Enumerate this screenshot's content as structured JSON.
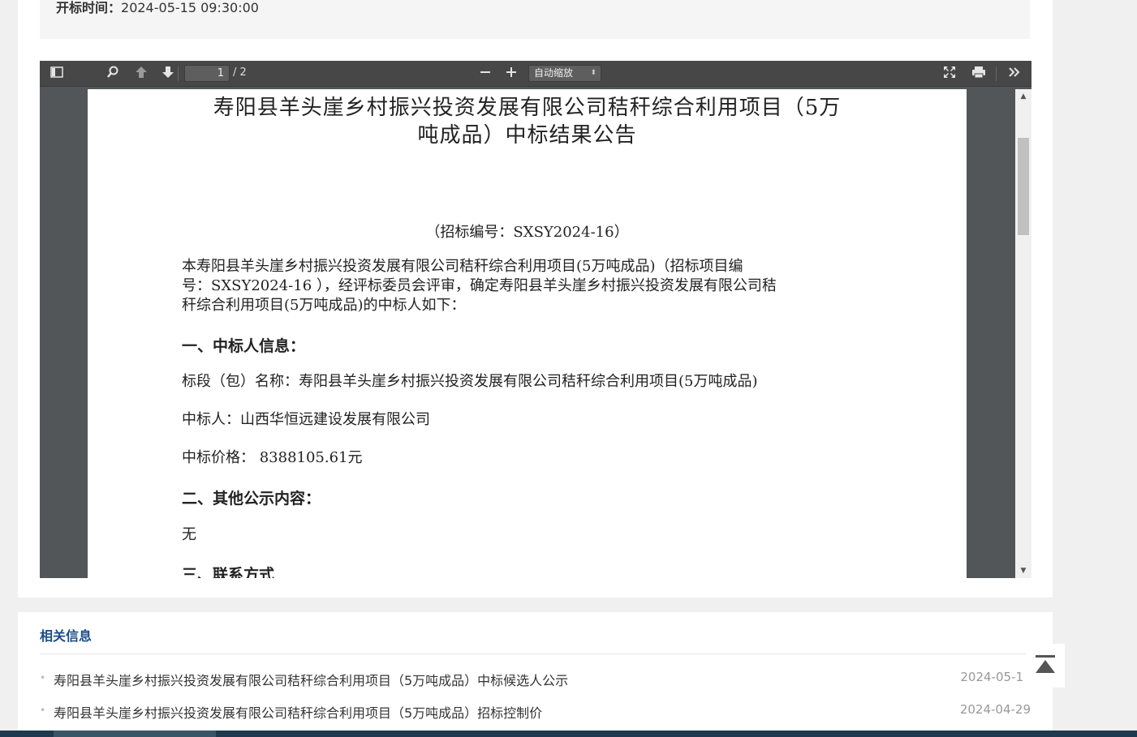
{
  "meta": {
    "label": "开标时间：",
    "value": "2024-05-15 09:30:00"
  },
  "viewer": {
    "current_page": "1",
    "total_pages": "/ 2",
    "zoom": "自动缩放",
    "icons": [
      "sidebar-toggle-icon",
      "search-icon",
      "arrow-up-icon",
      "arrow-down-icon",
      "zoom-out-icon",
      "zoom-in-icon",
      "fullscreen-icon",
      "print-icon",
      "more-tools-icon"
    ]
  },
  "document": {
    "title_line1": "寿阳县羊头崖乡村振兴投资发展有限公司秸秆综合利用项目（5万",
    "title_line2": "吨成品）中标结果公告",
    "bid_number": "（招标编号：SXSY2024-16）",
    "intro_line1": "本寿阳县羊头崖乡村振兴投资发展有限公司秸秆综合利用项目(5万吨成品)（招标项目编",
    "intro_line2": "号：SXSY2024-16 ），经评标委员会评审，确定寿阳县羊头崖乡村振兴投资发展有限公司秸",
    "intro_line3": "秆综合利用项目(5万吨成品)的中标人如下：",
    "section1": "一、中标人信息：",
    "lot_name": "标段（包）名称：寿阳县羊头崖乡村振兴投资发展有限公司秸秆综合利用项目(5万吨成品)",
    "winner": "中标人：山西华恒远建设发展有限公司",
    "price": "中标价格：  8388105.61元",
    "section2": "二、其他公示内容：",
    "other": "无",
    "section3": "三、联系方式"
  },
  "related": {
    "title": "相关信息",
    "items": [
      {
        "text": "寿阳县羊头崖乡村振兴投资发展有限公司秸秆综合利用项目（5万吨成品）中标候选人公示",
        "date": "2024-05-1"
      },
      {
        "text": "寿阳县羊头崖乡村振兴投资发展有限公司秸秆综合利用项目（5万吨成品）招标控制价",
        "date": "2024-04-29"
      }
    ]
  },
  "colors": {
    "accent": "#1a4c8a",
    "toolbar": "#474747",
    "viewer_bg": "#525659",
    "footer": "#1f3a4f"
  }
}
